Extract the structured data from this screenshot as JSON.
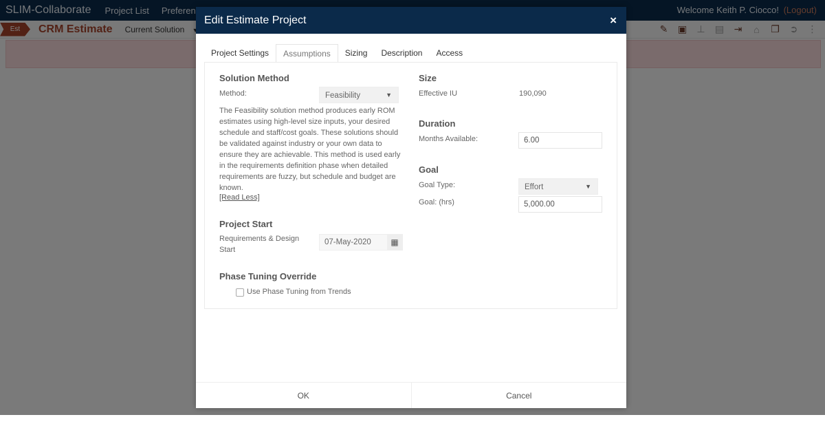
{
  "app": {
    "brand": "SLIM-Collaborate",
    "nav": [
      "Project List",
      "Preference"
    ],
    "welcome": "Welcome Keith P. Ciocco!",
    "logout": "(Logout)"
  },
  "subbar": {
    "badge": "Est",
    "project_title": "CRM Estimate",
    "solution_selector": "Current Solution",
    "toolbar_icons": [
      "pencil-icon",
      "save-icon",
      "pin-icon",
      "book-icon",
      "export-icon",
      "lock-icon",
      "comments-icon",
      "arrow-circle-right-icon",
      "more-icon"
    ]
  },
  "modal": {
    "title": "Edit Estimate Project",
    "close_label": "×",
    "tabs": [
      {
        "label": "Project Settings",
        "active": false
      },
      {
        "label": "Assumptions",
        "active": true
      },
      {
        "label": "Sizing",
        "active": false
      },
      {
        "label": "Description",
        "active": false
      },
      {
        "label": "Access",
        "active": false
      }
    ],
    "solution_method": {
      "title": "Solution Method",
      "method_label": "Method:",
      "method_value": "Feasibility",
      "description": "The Feasibility solution method produces early ROM estimates using high-level size inputs, your desired schedule and staff/cost goals. These solutions should be validated against industry or your own data to ensure they are achievable. This method is used early in the requirements definition phase when detailed requirements are fuzzy, but schedule and budget are known.",
      "read_less": "[Read Less]"
    },
    "project_start": {
      "title": "Project Start",
      "label": "Requirements & Design Start",
      "value": "07-May-2020"
    },
    "phase_tuning": {
      "title": "Phase Tuning Override",
      "checkbox_label": "Use Phase Tuning from Trends",
      "checked": false
    },
    "size": {
      "title": "Size",
      "label": "Effective IU",
      "value": "190,090"
    },
    "duration": {
      "title": "Duration",
      "label": "Months Available:",
      "value": "6.00"
    },
    "goal": {
      "title": "Goal",
      "type_label": "Goal Type:",
      "type_value": "Effort",
      "goal_label": "Goal: (hrs)",
      "goal_value": "5,000.00"
    },
    "ok_label": "OK",
    "cancel_label": "Cancel"
  }
}
